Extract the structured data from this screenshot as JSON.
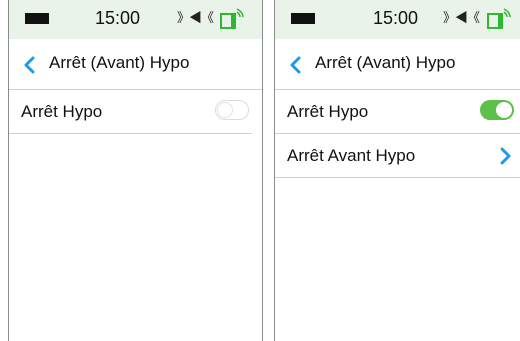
{
  "screens": [
    {
      "status": {
        "time": "15:00"
      },
      "nav": {
        "title": "Arrêt (Avant) Hypo"
      },
      "rows": [
        {
          "label": "Arrêt Hypo",
          "control": "toggle",
          "toggle_on": false
        }
      ]
    },
    {
      "status": {
        "time": "15:00"
      },
      "nav": {
        "title": "Arrêt (Avant) Hypo"
      },
      "rows": [
        {
          "label": "Arrêt Hypo",
          "control": "toggle",
          "toggle_on": true
        },
        {
          "label": "Arrêt Avant Hypo",
          "control": "chevron-right-icon"
        }
      ]
    }
  ],
  "icons": {
    "battery": "battery-icon",
    "sound": "sound-icon",
    "device": "device-status-icon",
    "back": "chevron-left-icon"
  },
  "colors": {
    "status_bar_bg": "#eaf3ea",
    "accent_blue": "#1e9be6",
    "toggle_on": "#5cc04a",
    "device_icon_green": "#2fb82f"
  }
}
